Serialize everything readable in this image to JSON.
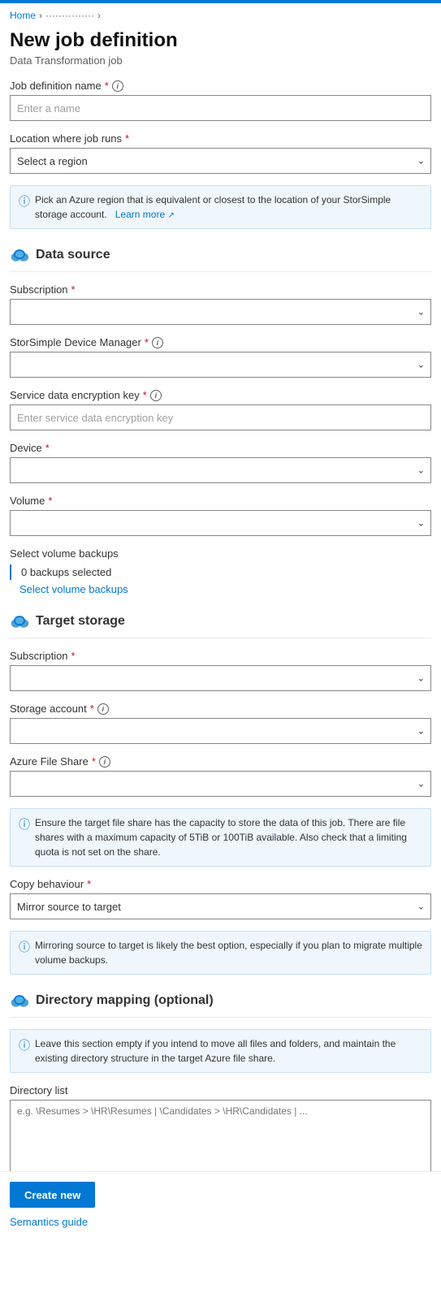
{
  "topbar": {
    "color": "#0078d4"
  },
  "breadcrumb": {
    "home": "Home",
    "separator1": "›",
    "workspace": "···············",
    "separator2": "›"
  },
  "header": {
    "title": "New job definition",
    "subtitle": "Data Transformation job"
  },
  "form": {
    "job_definition_name": {
      "label": "Job definition name",
      "required": true,
      "placeholder": "Enter a name"
    },
    "location": {
      "label": "Location where job runs",
      "required": true,
      "placeholder": "Select a region"
    },
    "location_info": "Pick an Azure region that is equivalent or closest to the location of your StorSimple storage account.",
    "location_learn_more": "Learn more",
    "data_source_section": "Data source",
    "subscription_source": {
      "label": "Subscription",
      "required": true
    },
    "storsimple_manager": {
      "label": "StorSimple Device Manager",
      "required": true,
      "has_info": true
    },
    "service_data_key": {
      "label": "Service data encryption key",
      "required": true,
      "has_info": true,
      "placeholder": "Enter service data encryption key"
    },
    "device": {
      "label": "Device",
      "required": true
    },
    "volume": {
      "label": "Volume",
      "required": true
    },
    "select_volume_backups": {
      "label": "Select volume backups",
      "count": "0 backups selected",
      "link": "Select volume backups"
    },
    "target_storage_section": "Target storage",
    "subscription_target": {
      "label": "Subscription",
      "required": true
    },
    "storage_account": {
      "label": "Storage account",
      "required": true,
      "has_info": true
    },
    "azure_file_share": {
      "label": "Azure File Share",
      "required": true,
      "has_info": true
    },
    "file_share_info": "Ensure the target file share has the capacity to store the data of this job. There are file shares with a maximum capacity of 5TiB or 100TiB available. Also check that a limiting quota is not set on the share.",
    "copy_behaviour": {
      "label": "Copy behaviour",
      "required": true,
      "value": "Mirror source to target"
    },
    "mirror_info": "Mirroring source to target is likely the best option, especially if you plan to migrate multiple volume backups.",
    "directory_mapping_section": "Directory mapping (optional)",
    "directory_mapping_info": "Leave this section empty if you intend to move all files and folders, and maintain the existing directory structure in the target Azure file share.",
    "directory_list": {
      "label": "Directory list",
      "placeholder": "e.g. \\Resumes > \\HR\\Resumes | \\Candidates > \\HR\\Candidates | ..."
    },
    "semantics_guide": "Semantics guide"
  },
  "footer": {
    "create_button": "Create new"
  }
}
